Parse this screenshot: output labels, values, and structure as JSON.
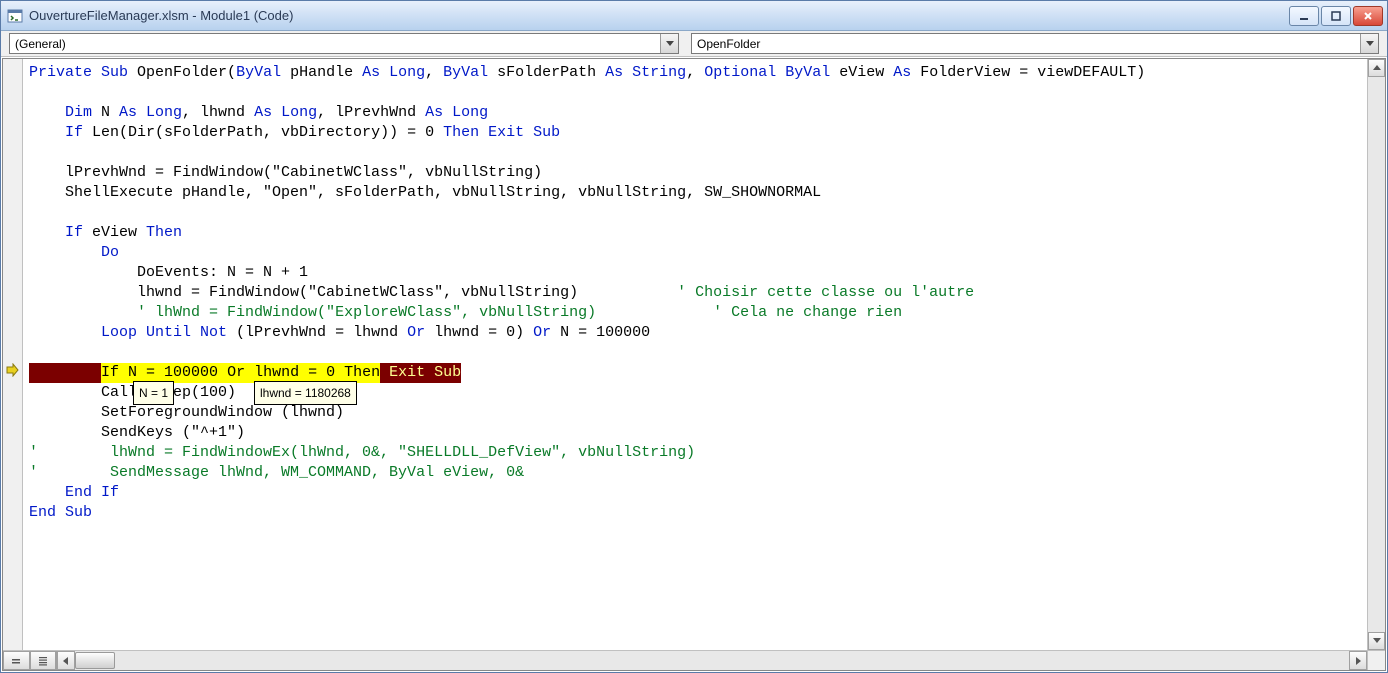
{
  "window": {
    "title": "OuvertureFileManager.xlsm - Module1 (Code)"
  },
  "dropdowns": {
    "scope": "(General)",
    "proc": "OpenFolder"
  },
  "tooltips": {
    "n": "N = 1",
    "lhwnd": "lhwnd = 1180268"
  },
  "code": {
    "l1a": "Private Sub",
    "l1b": " OpenFolder(",
    "l1c": "ByVal",
    "l1d": " pHandle ",
    "l1e": "As Long",
    "l1f": ", ",
    "l1g": "ByVal",
    "l1h": " sFolderPath ",
    "l1i": "As String",
    "l1j": ", ",
    "l1k": "Optional ByVal",
    "l1l": " eView ",
    "l1m": "As",
    "l1n": " FolderView = viewDEFAULT)",
    "l3a": "    Dim",
    "l3b": " N ",
    "l3c": "As Long",
    "l3d": ", lhwnd ",
    "l3e": "As Long",
    "l3f": ", lPrevhWnd ",
    "l3g": "As Long",
    "l4a": "    If",
    "l4b": " Len(Dir(sFolderPath, vbDirectory)) = 0 ",
    "l4c": "Then Exit Sub",
    "l6": "    lPrevhWnd = FindWindow(\"CabinetWClass\", vbNullString)",
    "l7": "    ShellExecute pHandle, \"Open\", sFolderPath, vbNullString, vbNullString, SW_SHOWNORMAL",
    "l9a": "    If",
    "l9b": " eView ",
    "l9c": "Then",
    "l10": "        Do",
    "l11": "            DoEvents: N = N + 1",
    "l12a": "            lhwnd = FindWindow(\"CabinetWClass\", vbNullString)           ",
    "l12b": "' Choisir cette classe ou l'autre",
    "l13a": "            ",
    "l13b": "' lhWnd = FindWindow(\"ExploreWClass\", vbNullString)             ' Cela ne change rien",
    "l14a": "        Loop Until Not",
    "l14b": " (lPrevhWnd = lhwnd ",
    "l14c": "Or",
    "l14d": " lhwnd = 0) ",
    "l14e": "Or",
    "l14f": " N = 100000",
    "l16pad": "        ",
    "l16a": "If",
    "l16b": " N = 100000 ",
    "l16c": "Or",
    "l16d": " lhwnd = 0 ",
    "l16e": "Then",
    "l16f": " Exit Sub",
    "l17": "        Call Sleep(100)",
    "l18": "        SetForegroundWindow (lhwnd)",
    "l19": "        SendKeys (\"^+1\")",
    "l20": "'        lhWnd = FindWindowEx(lhWnd, 0&, \"SHELLDLL_DefView\", vbNullString)",
    "l21": "'        SendMessage lhWnd, WM_COMMAND, ByVal eView, 0&",
    "l22a": "    End If",
    "l23a": "End Sub"
  }
}
